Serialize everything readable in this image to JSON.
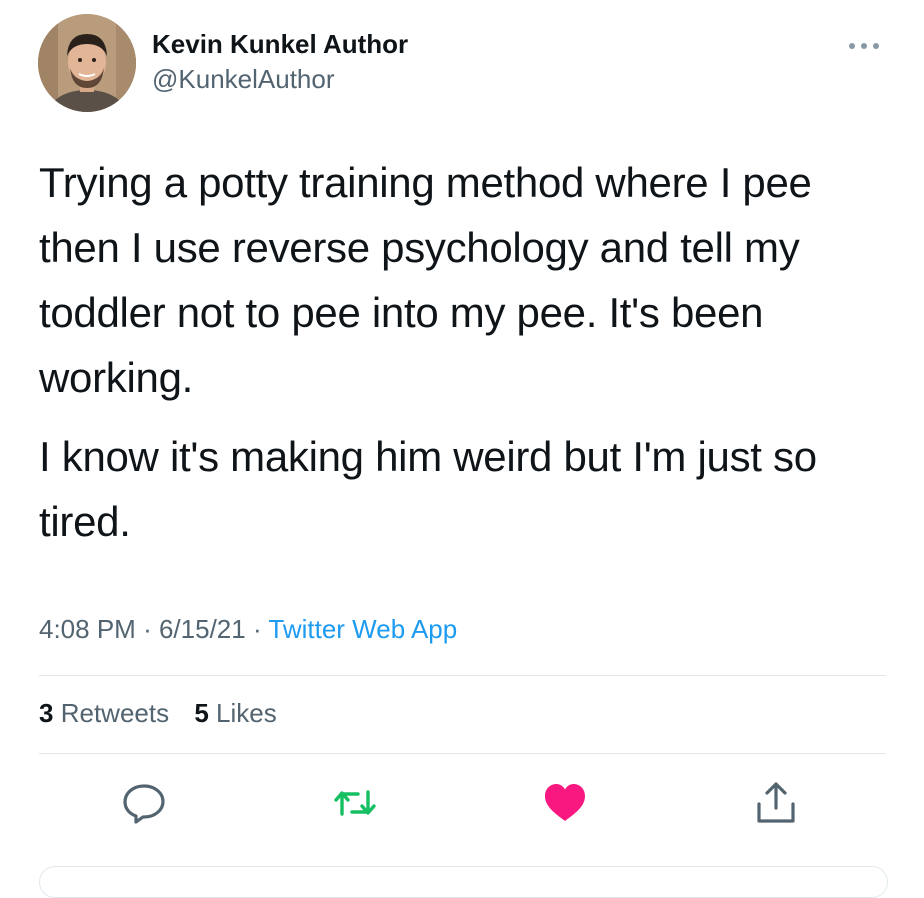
{
  "author": {
    "name": "Kevin Kunkel Author",
    "handle": "@KunkelAuthor"
  },
  "tweet": {
    "paragraphs": [
      "Trying a potty training method where I pee then I use reverse psychology and tell my toddler not to pee into my pee. It's been working.",
      "I know it's making him weird but I'm just so tired."
    ]
  },
  "meta": {
    "time": "4:08 PM",
    "separator": "·",
    "date": "6/15/21",
    "source": "Twitter Web App"
  },
  "stats": {
    "retweets_count": "3",
    "retweets_label": "Retweets",
    "likes_count": "5",
    "likes_label": "Likes"
  },
  "icons": {
    "more": "more-horizontal-icon",
    "reply": "reply-bubble-icon",
    "retweet": "retweet-icon",
    "like": "heart-icon",
    "share": "share-icon"
  },
  "colors": {
    "retweet_green": "#17bf63",
    "like_pink": "#f91880",
    "link_blue": "#1d9bf0",
    "secondary_text": "#536471"
  },
  "state": {
    "retweeted": true,
    "liked": true
  }
}
